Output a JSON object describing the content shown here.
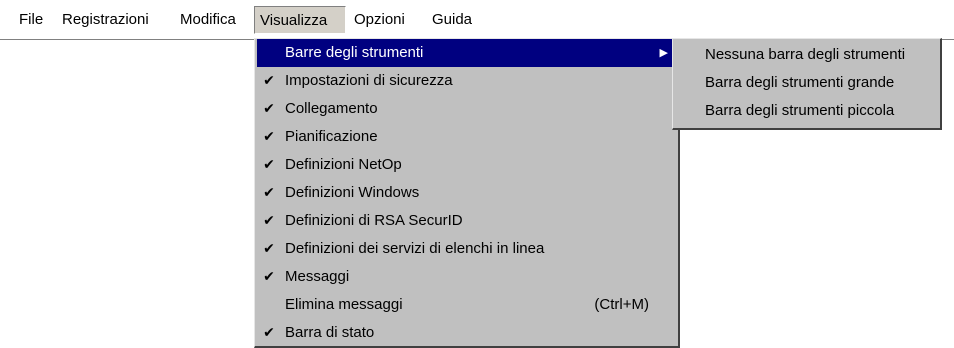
{
  "menubar": {
    "items": [
      {
        "label": "File"
      },
      {
        "label": "Registrazioni"
      },
      {
        "label": "Modifica"
      },
      {
        "label": "Visualizza"
      },
      {
        "label": "Opzioni"
      },
      {
        "label": "Guida"
      }
    ]
  },
  "visualizza_menu": {
    "items": [
      {
        "label": "Barre degli strumenti",
        "checked": false,
        "has_submenu": true,
        "highlighted": true
      },
      {
        "label": "Impostazioni di sicurezza",
        "checked": true
      },
      {
        "label": "Collegamento",
        "checked": true
      },
      {
        "label": "Pianificazione",
        "checked": true
      },
      {
        "label": "Definizioni NetOp",
        "checked": true
      },
      {
        "label": "Definizioni Windows",
        "checked": true
      },
      {
        "label": "Definizioni di RSA SecurID",
        "checked": true
      },
      {
        "label": "Definizioni dei servizi di elenchi in linea",
        "checked": true
      },
      {
        "label": "Messaggi",
        "checked": true
      },
      {
        "label": "Elimina messaggi",
        "checked": false,
        "shortcut": "(Ctrl+M)"
      },
      {
        "label": "Barra di stato",
        "checked": true
      }
    ],
    "check_glyph": "✔",
    "submenu_arrow": "▶"
  },
  "toolbar_submenu": {
    "items": [
      {
        "label": "Nessuna barra degli strumenti"
      },
      {
        "label": "Barra degli strumenti grande"
      },
      {
        "label": "Barra degli strumenti piccola"
      }
    ]
  },
  "colors": {
    "menu_background": "#c0c0c0",
    "highlight": "#000080",
    "highlight_text": "#ffffff"
  }
}
